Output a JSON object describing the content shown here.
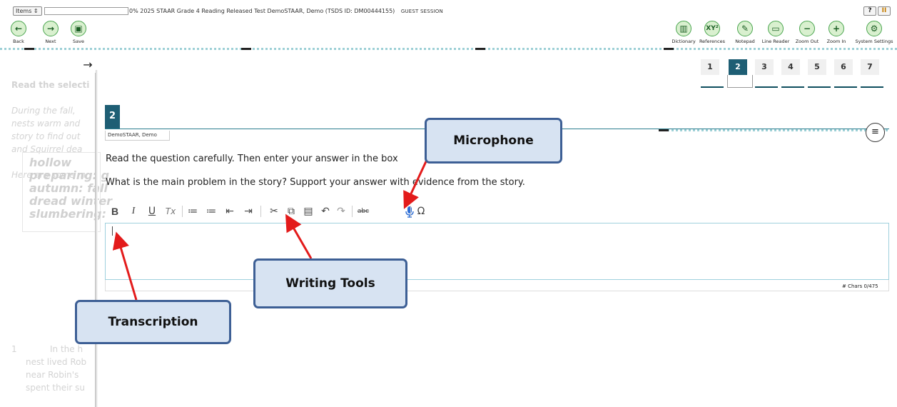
{
  "topbar": {
    "items_label": "Items",
    "progress_text": "0%",
    "test_title": "2025 STAAR Grade 4 Reading Released Test",
    "student": "DemoSTAAR, Demo (TSDS ID: DM00444155)",
    "session": "GUEST SESSION",
    "help_label": "?",
    "pause_label": "II"
  },
  "toolbar": {
    "back": "Back",
    "next": "Next",
    "save": "Save",
    "dictionary": "Dictionary",
    "references": "References",
    "notepad": "Notepad",
    "line_reader": "Line Reader",
    "zoom_out": "Zoom Out",
    "zoom_in": "Zoom In",
    "system_settings": "System Settings",
    "references_icon_text": "XY²"
  },
  "passage": {
    "heading": "Read the selecti",
    "intro": [
      "During the fall,",
      "nests warm and",
      "story to find out",
      "and Squirrel dea"
    ],
    "note": "Here are some m",
    "vocab": [
      "hollow",
      "preparing: g",
      "autumn: fall",
      "dread winter",
      "slumbering:"
    ],
    "para_number": "1",
    "para_lines": [
      "In the h",
      "nest lived Rob",
      "near Robin's",
      "spent their su"
    ]
  },
  "question_tabs": [
    "1",
    "2",
    "3",
    "4",
    "5",
    "6",
    "7"
  ],
  "active_tab": "2",
  "question": {
    "number": "2",
    "student_name": "DemoSTAAR, Demo",
    "instruction": "Read the question carefully. Then enter your answer in the box",
    "prompt": "What is the main problem in the story? Support your answer with evidence from the story."
  },
  "editor": {
    "tools": [
      "B",
      "I",
      "U",
      "Tx",
      "≔",
      "≔",
      "⇤",
      "⇥",
      "✂",
      "⧉",
      "▤",
      "↶",
      "↷",
      "abc",
      "mic",
      "Ω"
    ],
    "char_count": "# Chars 0/475"
  },
  "callouts": {
    "microphone": "Microphone",
    "writing_tools": "Writing Tools",
    "transcription": "Transcription"
  },
  "colors": {
    "accent": "#1e5e74",
    "tool_green": "#6cc56b",
    "callout_fill": "#d7e3f2",
    "callout_border": "#3d5f95",
    "arrow": "#e31b1b"
  }
}
